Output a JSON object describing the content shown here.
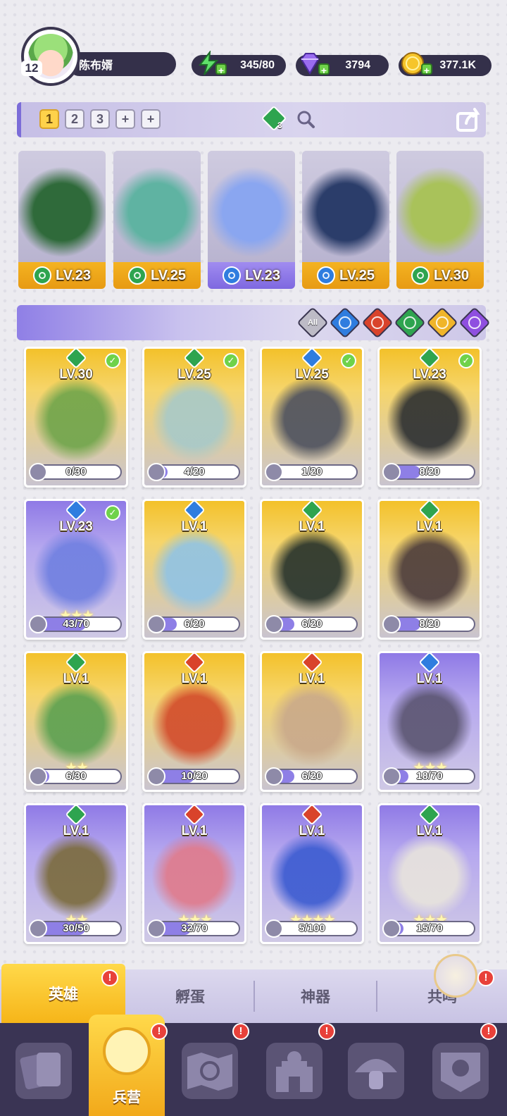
{
  "player": {
    "level": "12",
    "name": "陈布婿"
  },
  "resources": {
    "energy": {
      "value": "345/80",
      "icon": "lightning-icon"
    },
    "gems": {
      "value": "3794",
      "icon": "gem-icon"
    },
    "gold": {
      "value": "377.1K",
      "icon": "coin-icon"
    }
  },
  "team_slots": [
    "1",
    "2",
    "3",
    "+",
    "+"
  ],
  "team_count_badge": "3",
  "team_cards": [
    {
      "level": "LV.23",
      "element": "g",
      "color": "#2f6a3a",
      "highlight": false
    },
    {
      "level": "LV.25",
      "element": "g",
      "color": "#5fb3a2",
      "highlight": false
    },
    {
      "level": "LV.23",
      "element": "b",
      "color": "#8aa6f0",
      "highlight": true
    },
    {
      "level": "LV.25",
      "element": "b",
      "color": "#2b3d6a",
      "highlight": false
    },
    {
      "level": "LV.30",
      "element": "g",
      "color": "#a9c25a",
      "highlight": false
    }
  ],
  "filter_all_label": "All",
  "filters": [
    "b",
    "r",
    "g",
    "y",
    "p"
  ],
  "heroes": [
    {
      "level": "LV.30",
      "element": "g",
      "progress": "0/30",
      "ratio": 0.0,
      "frame": "gold",
      "checked": true,
      "stars": "",
      "color": "#6ea44a"
    },
    {
      "level": "LV.25",
      "element": "g",
      "progress": "4/20",
      "ratio": 0.2,
      "frame": "gold",
      "checked": true,
      "stars": "",
      "color": "#a7c9c9"
    },
    {
      "level": "LV.25",
      "element": "b",
      "progress": "1/20",
      "ratio": 0.05,
      "frame": "gold",
      "checked": true,
      "stars": "",
      "color": "#4b4f5e"
    },
    {
      "level": "LV.23",
      "element": "g",
      "progress": "8/20",
      "ratio": 0.4,
      "frame": "gold",
      "checked": true,
      "stars": "",
      "color": "#2a2d30"
    },
    {
      "level": "LV.23",
      "element": "b",
      "progress": "43/70",
      "ratio": 0.61,
      "frame": "purple",
      "checked": true,
      "stars": "★★★",
      "color": "#6f7fe0"
    },
    {
      "level": "LV.1",
      "element": "b",
      "progress": "6/20",
      "ratio": 0.3,
      "frame": "gold",
      "checked": false,
      "stars": "",
      "color": "#8fc3e6"
    },
    {
      "level": "LV.1",
      "element": "g",
      "progress": "6/20",
      "ratio": 0.3,
      "frame": "gold",
      "checked": false,
      "stars": "",
      "color": "#24302a"
    },
    {
      "level": "LV.1",
      "element": "g",
      "progress": "8/20",
      "ratio": 0.4,
      "frame": "gold",
      "checked": false,
      "stars": "",
      "color": "#4a3a3a"
    },
    {
      "level": "LV.1",
      "element": "g",
      "progress": "6/30",
      "ratio": 0.2,
      "frame": "gold",
      "checked": false,
      "stars": "★★",
      "color": "#5aa050"
    },
    {
      "level": "LV.1",
      "element": "r",
      "progress": "10/20",
      "ratio": 0.5,
      "frame": "gold",
      "checked": false,
      "stars": "",
      "color": "#d24a2a"
    },
    {
      "level": "LV.1",
      "element": "r",
      "progress": "6/20",
      "ratio": 0.3,
      "frame": "gold",
      "checked": false,
      "stars": "",
      "color": "#c9a98a"
    },
    {
      "level": "LV.1",
      "element": "b",
      "progress": "18/70",
      "ratio": 0.26,
      "frame": "purple",
      "checked": false,
      "stars": "★★★",
      "color": "#5a5470"
    },
    {
      "level": "LV.1",
      "element": "g",
      "progress": "30/50",
      "ratio": 0.6,
      "frame": "purple",
      "checked": false,
      "stars": "★★",
      "color": "#7a6a3a"
    },
    {
      "level": "LV.1",
      "element": "r",
      "progress": "32/70",
      "ratio": 0.46,
      "frame": "purple",
      "checked": false,
      "stars": "★★★",
      "color": "#e07a8a"
    },
    {
      "level": "LV.1",
      "element": "r",
      "progress": "5/100",
      "ratio": 0.05,
      "frame": "purple",
      "checked": false,
      "stars": "★★★★",
      "color": "#3a5ad0"
    },
    {
      "level": "LV.1",
      "element": "g",
      "progress": "15/70",
      "ratio": 0.21,
      "frame": "purple",
      "checked": false,
      "stars": "★★★",
      "color": "#e8e4dc"
    }
  ],
  "tabs": [
    {
      "label": "英雄",
      "active": true,
      "badge": "!"
    },
    {
      "label": "孵蛋",
      "active": false,
      "badge": ""
    },
    {
      "label": "神器",
      "active": false,
      "badge": ""
    },
    {
      "label": "共鸣",
      "active": false,
      "badge": "!"
    }
  ],
  "nav": {
    "items": [
      {
        "name": "cards",
        "badge": ""
      },
      {
        "name": "barracks",
        "badge": "!",
        "label": "兵营"
      },
      {
        "name": "map",
        "badge": "!"
      },
      {
        "name": "castle",
        "badge": "!"
      },
      {
        "name": "mushroom",
        "badge": ""
      },
      {
        "name": "guild",
        "badge": "!"
      }
    ],
    "active_label": "兵营"
  }
}
